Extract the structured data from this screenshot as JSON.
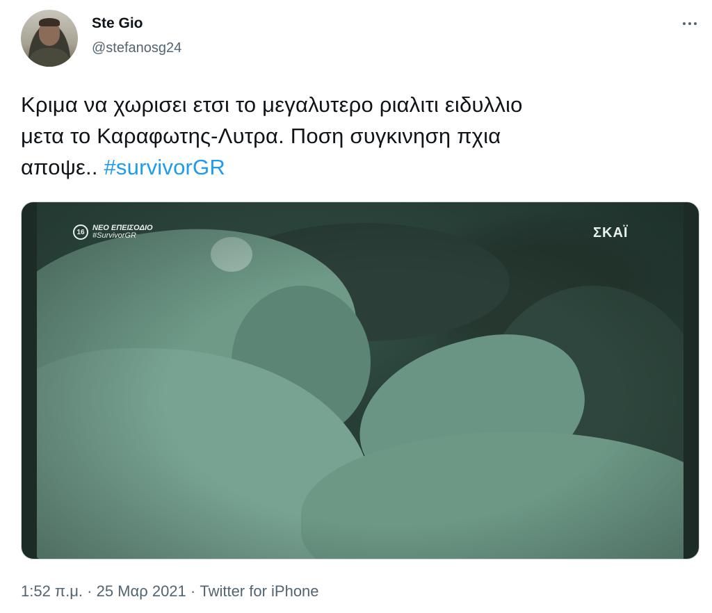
{
  "author": {
    "name": "Ste Gio",
    "handle": "@stefanosg24"
  },
  "tweet": {
    "text_lines": [
      "Κριμα να χωρισει ετσι το μεγαλυτερο ριαλιτι ειδυλλιο",
      "μετα το Καραφωτης-Λυτρα. Ποση συγκινηση πχια",
      "αποψε.. "
    ],
    "hashtag": "#survivorGR"
  },
  "media": {
    "overlay": {
      "rating": "16",
      "episode_label": "ΝΕΟ ΕΠΕΙΣΟΔΙΟ",
      "episode_tag": "#SurvivorGR",
      "channel_logo": "ΣΚΑΪ"
    }
  },
  "meta": {
    "time": "1:52 π.μ.",
    "separator": " · ",
    "date": "25 Μαρ 2021",
    "source": "Twitter for iPhone"
  },
  "icons": {
    "more": "more-horizontal-icon"
  },
  "colors": {
    "text": "#0f1419",
    "secondary": "#536471",
    "link": "#1d9bf0"
  }
}
